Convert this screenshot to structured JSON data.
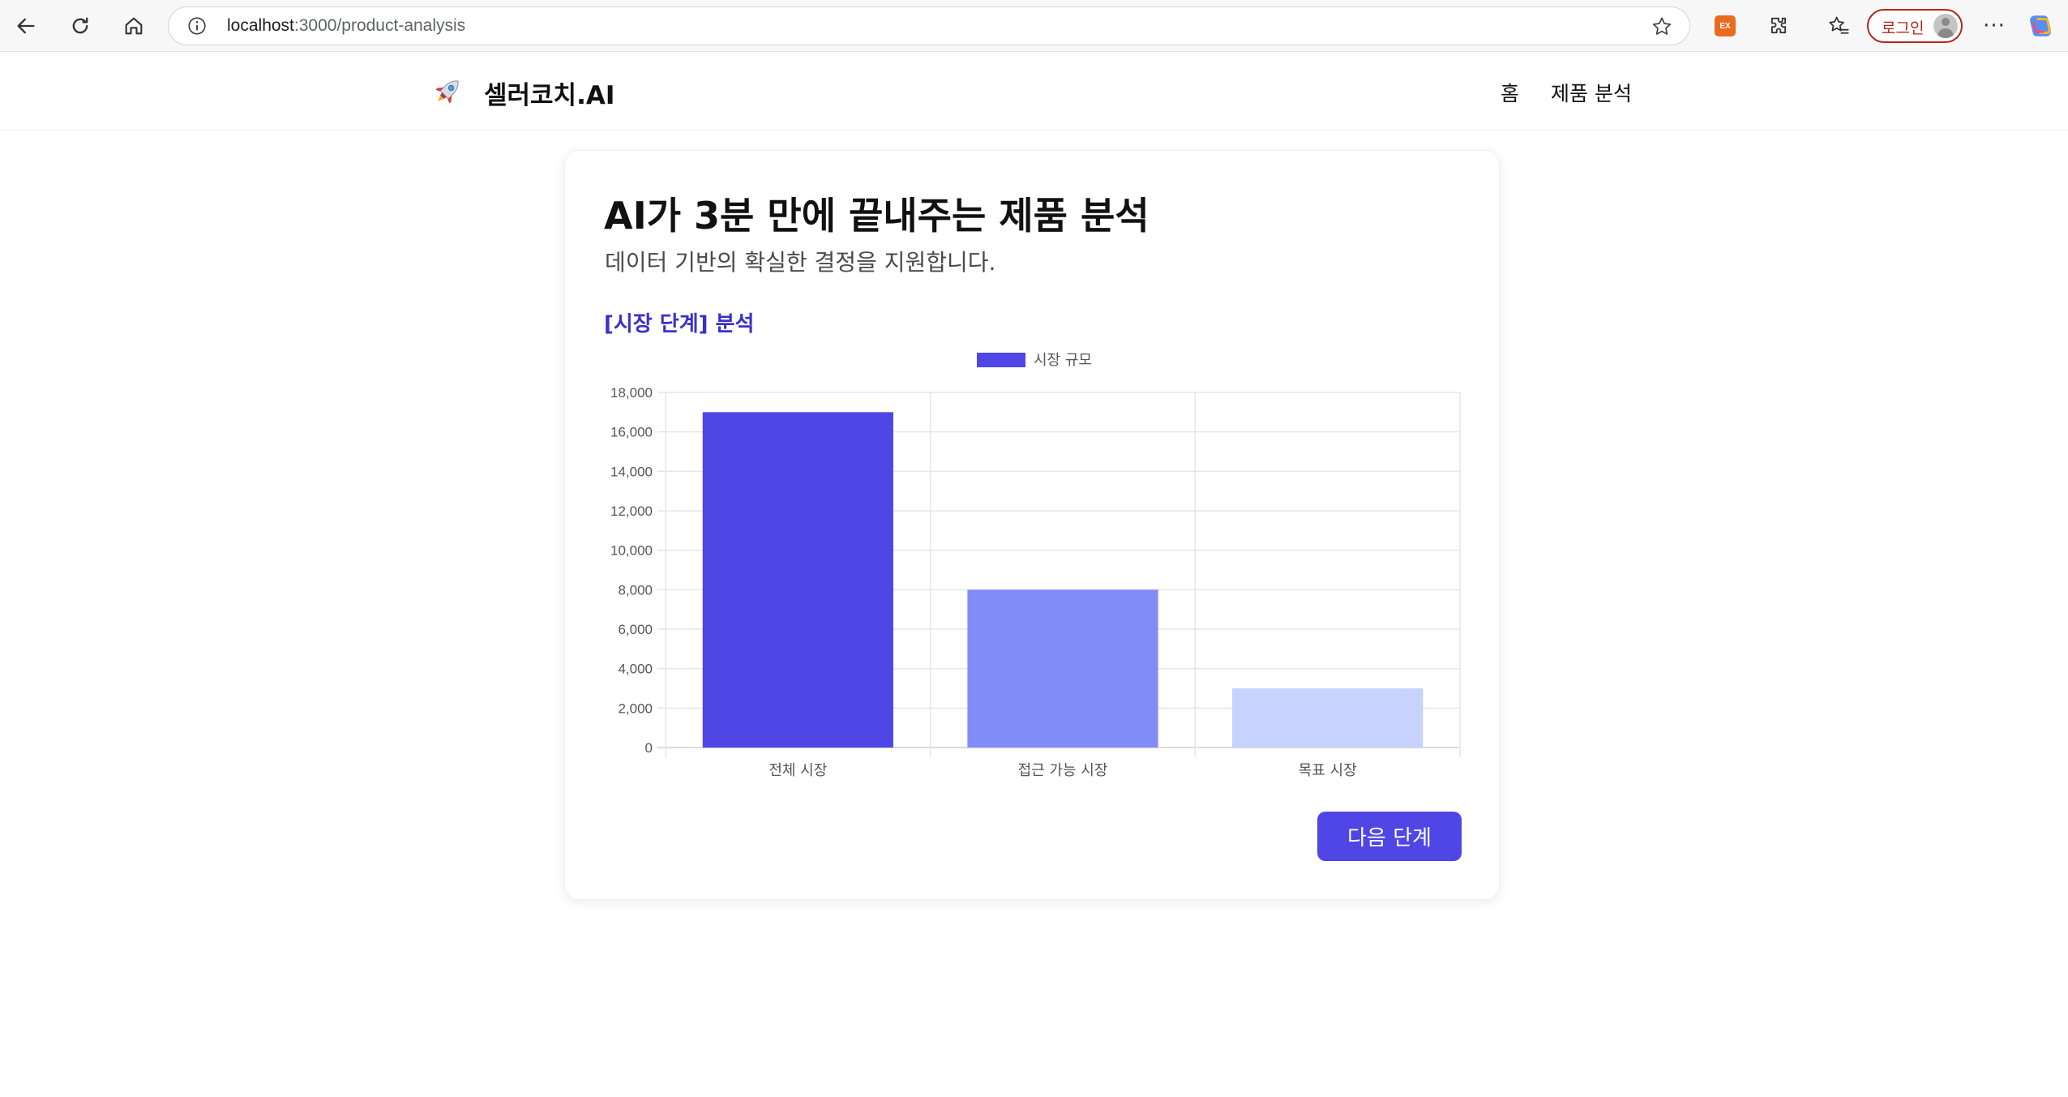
{
  "browser": {
    "url_host": "localhost",
    "url_path": ":3000/product-analysis",
    "extension_badge": "EX",
    "profile_label": "로그인",
    "more_label": "···"
  },
  "header": {
    "logo_text": "셀러코치.AI",
    "nav": [
      "홈",
      "제품 분석"
    ]
  },
  "main": {
    "title": "AI가 3분 만에 끝내주는 제품 분석",
    "subtitle": "데이터 기반의 확실한 결정을 지원합니다.",
    "section_label": "[시장 단계] 분석",
    "next_button": "다음 단계"
  },
  "chart_data": {
    "type": "bar",
    "legend": [
      {
        "label": "시장 규모",
        "color": "#4f46e5"
      }
    ],
    "legend_position": "top-center",
    "categories": [
      "전체 시장",
      "접근 가능 시장",
      "목표 시장"
    ],
    "series": [
      {
        "name": "시장 규모",
        "values": [
          17000,
          8000,
          3000
        ],
        "colors": [
          "#4f46e5",
          "#818cf8",
          "#c7d2fe"
        ]
      }
    ],
    "ylim": [
      0,
      18000
    ],
    "yticks": [
      "0",
      "2,000",
      "4,000",
      "6,000",
      "8,000",
      "10,000",
      "12,000",
      "14,000",
      "16,000",
      "18,000"
    ],
    "grid": true
  }
}
